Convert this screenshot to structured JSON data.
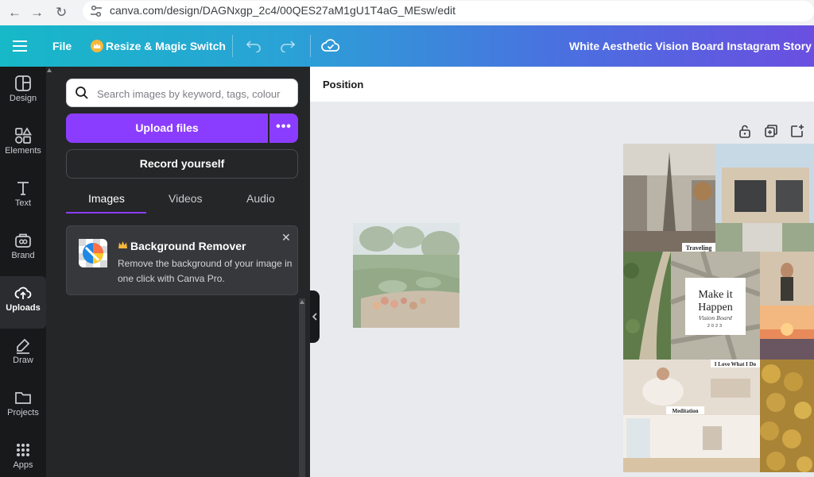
{
  "browser": {
    "url": "canva.com/design/DAGNxgp_2c4/00QES27aM1gU1T4aG_MEsw/edit"
  },
  "header": {
    "file_label": "File",
    "resize_label": "Resize & Magic Switch",
    "doc_title": "White Aesthetic Vision Board Instagram Story"
  },
  "rail": {
    "items": [
      {
        "label": "Design"
      },
      {
        "label": "Elements"
      },
      {
        "label": "Text"
      },
      {
        "label": "Brand"
      },
      {
        "label": "Uploads"
      },
      {
        "label": "Draw"
      },
      {
        "label": "Projects"
      },
      {
        "label": "Apps"
      }
    ],
    "active": "Uploads"
  },
  "panel": {
    "search_placeholder": "Search images by keyword, tags, colour",
    "upload_label": "Upload files",
    "more_label": "•••",
    "record_label": "Record yourself",
    "tabs": [
      {
        "label": "Images"
      },
      {
        "label": "Videos"
      },
      {
        "label": "Audio"
      }
    ],
    "active_tab": "Images",
    "promo": {
      "title": "Background Remover",
      "body": "Remove the background of your image in one click with Canva Pro."
    }
  },
  "toolbar": {
    "position_label": "Position"
  },
  "canvas": {
    "collage_labels": {
      "traveling": "Traveling",
      "make_it": "Make it",
      "happen": "Happen",
      "vision_board": "Vision Board",
      "year": "2023",
      "love": "I Love What I Do",
      "meditation": "Meditation"
    }
  },
  "colors": {
    "accent": "#8b3dff",
    "header_start": "#17b8c8",
    "header_end": "#6a4fe0"
  }
}
